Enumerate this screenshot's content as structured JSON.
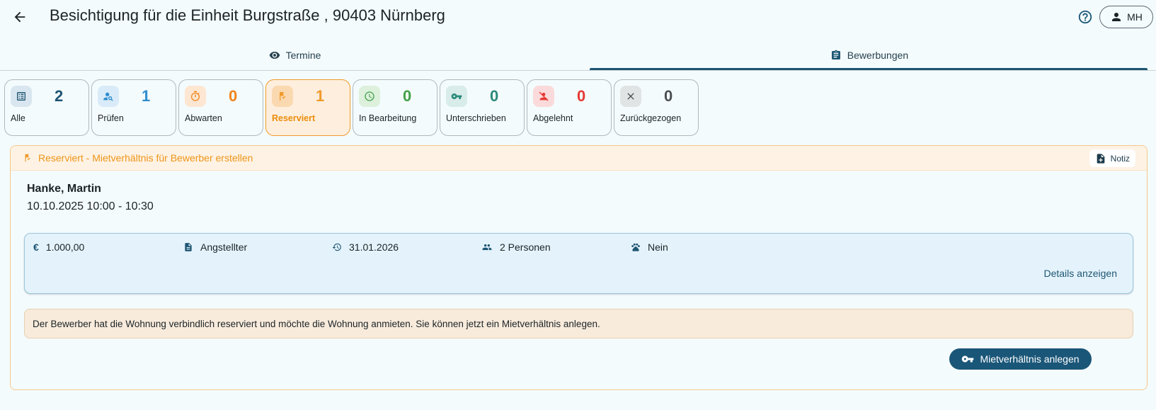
{
  "header": {
    "title": "Besichtigung für die Einheit Burgstraße , 90403 Nürnberg",
    "user_initials": "MH"
  },
  "tabs": [
    {
      "label": "Termine",
      "icon": "eye-icon"
    },
    {
      "label": "Bewerbungen",
      "icon": "clipboard-icon",
      "active": true
    }
  ],
  "status_cards": [
    {
      "label": "Alle",
      "count": "2",
      "color": "#1e5673",
      "bg": "#d9e6ef"
    },
    {
      "label": "Prüfen",
      "count": "1",
      "color": "#2f8ecf",
      "bg": "#d9ebf8"
    },
    {
      "label": "Abwarten",
      "count": "0",
      "color": "#f0851a",
      "bg": "#fde6d2"
    },
    {
      "label": "Reserviert",
      "count": "1",
      "color": "#f19a2a",
      "bg": "#fbd9b0",
      "active": true
    },
    {
      "label": "In Bearbeitung",
      "count": "0",
      "color": "#43a047",
      "bg": "#dcf0dc"
    },
    {
      "label": "Unterschrieben",
      "count": "0",
      "color": "#2a8a7a",
      "bg": "#d8ece9"
    },
    {
      "label": "Abgelehnt",
      "count": "0",
      "color": "#e53935",
      "bg": "#fadada"
    },
    {
      "label": "Zurückgezogen",
      "count": "0",
      "color": "#4a4f52",
      "bg": "#e1e4e5"
    }
  ],
  "section": {
    "title": "Reserviert - Mietverhältnis für Bewerber erstellen",
    "note_label": "Notiz",
    "applicant_name": "Hanke, Martin",
    "appointment": "10.10.2025 10:00 - 10:30",
    "info": {
      "rent": "1.000,00",
      "employment": "Angstellter",
      "move_in": "31.01.2026",
      "persons": "2 Personen",
      "pets": "Nein"
    },
    "details_link": "Details anzeigen",
    "hint": "Der Bewerber hat die Wohnung verbindlich reserviert und möchte die Wohnung anmieten. Sie können jetzt ein Mietverhältnis anlegen.",
    "primary_button": "Mietverhältnis anlegen"
  },
  "colors": {
    "primary": "#1a5678",
    "reserved": "#f19a2a",
    "page_bg": "#f4fbfd"
  }
}
